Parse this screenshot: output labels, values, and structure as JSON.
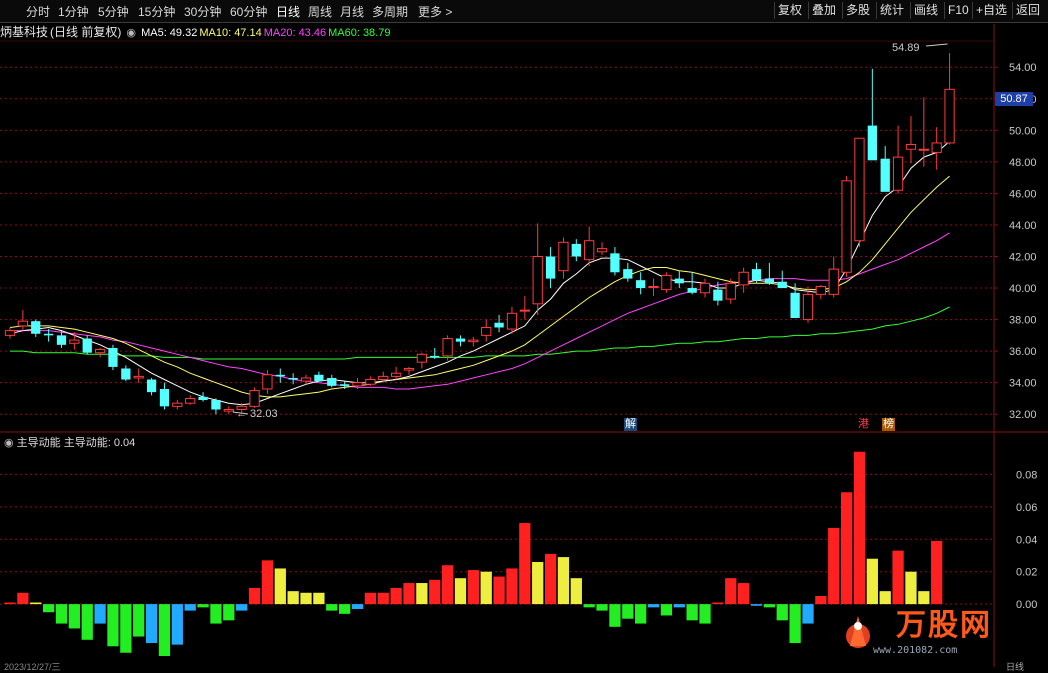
{
  "toolbar": {
    "periods": [
      "分时",
      "1分钟",
      "5分钟",
      "15分钟",
      "30分钟",
      "60分钟",
      "日线",
      "周线",
      "月线",
      "多周期",
      "更多 >"
    ],
    "active_period": "日线",
    "right_buttons": [
      "复权",
      "叠加",
      "多股",
      "统计",
      "画线",
      "F10",
      "+自选",
      "返回"
    ]
  },
  "header": {
    "stock_name": "炳基科技",
    "mode": "(日线 前复权)",
    "ma_labels": [
      {
        "text": "MA5: 49.32",
        "color": "#ffffff"
      },
      {
        "text": "MA10: 47.14",
        "color": "#ffff66"
      },
      {
        "text": "MA20: 43.46",
        "color": "#ff44ff"
      },
      {
        "text": "MA60: 38.79",
        "color": "#33ff33"
      }
    ]
  },
  "indicator": {
    "name": "主导动能",
    "value_label": "主导动能: 0.04"
  },
  "annotations": {
    "current_price": "50.87",
    "peak_label": "54.89",
    "low_label": "← 32.03",
    "tag_jie": "解",
    "tag_gang": "港",
    "tag_bang": "榜",
    "bottom_date": "2023/12/27/三",
    "bottom_right": "日线"
  },
  "watermark": {
    "text": "万股网",
    "url": "www.201082.com"
  },
  "colors": {
    "up": "#ff3b3b",
    "down": "#54ffff",
    "bar_red": "#ff2020",
    "bar_yellow": "#eeee40",
    "bar_green": "#22ee22",
    "bar_blue": "#22aaff",
    "grid": "#8a1010"
  },
  "chart_data": [
    {
      "type": "candlestick",
      "title": "",
      "ylim": [
        31,
        55.6
      ],
      "y_ticks": [
        32,
        34,
        36,
        38,
        40,
        42,
        44,
        46,
        48,
        50,
        52,
        54
      ],
      "y_tick_labels": [
        "32.00",
        "34.00",
        "36.00",
        "38.00",
        "40.00",
        "42.00",
        "44.00",
        "46.00",
        "48.00",
        "50.00",
        "52.00",
        "54.00"
      ],
      "ohlc": [
        [
          37.0,
          37.5,
          36.8,
          37.3
        ],
        [
          37.6,
          38.6,
          37.3,
          37.9
        ],
        [
          37.9,
          38.0,
          36.9,
          37.1
        ],
        [
          37.1,
          37.4,
          36.6,
          37.0
        ],
        [
          37.0,
          37.3,
          36.2,
          36.4
        ],
        [
          36.5,
          37.2,
          36.1,
          36.7
        ],
        [
          36.8,
          37.0,
          35.8,
          35.9
        ],
        [
          35.9,
          36.2,
          35.6,
          36.1
        ],
        [
          36.2,
          36.4,
          34.8,
          35.0
        ],
        [
          34.9,
          35.1,
          34.1,
          34.2
        ],
        [
          34.3,
          34.9,
          34.0,
          34.4
        ],
        [
          34.2,
          34.3,
          33.2,
          33.4
        ],
        [
          33.6,
          34.0,
          32.3,
          32.5
        ],
        [
          32.5,
          32.9,
          32.3,
          32.7
        ],
        [
          32.7,
          33.2,
          32.6,
          33.0
        ],
        [
          33.1,
          33.4,
          32.8,
          32.9
        ],
        [
          32.9,
          33.0,
          32.0,
          32.3
        ],
        [
          32.2,
          32.5,
          32.0,
          32.3
        ],
        [
          32.3,
          32.7,
          32.1,
          32.5
        ],
        [
          32.5,
          33.7,
          32.4,
          33.5
        ],
        [
          33.6,
          34.8,
          33.3,
          34.5
        ],
        [
          34.5,
          34.9,
          34.0,
          34.4
        ],
        [
          34.3,
          34.6,
          33.9,
          34.2
        ],
        [
          34.1,
          34.5,
          33.9,
          34.3
        ],
        [
          34.5,
          34.7,
          34.1,
          34.1
        ],
        [
          34.3,
          34.5,
          33.7,
          33.8
        ],
        [
          33.9,
          34.1,
          33.6,
          33.8
        ],
        [
          33.8,
          34.3,
          33.6,
          34.0
        ],
        [
          33.9,
          34.4,
          33.8,
          34.2
        ],
        [
          34.2,
          34.7,
          34.0,
          34.4
        ],
        [
          34.4,
          35.0,
          34.2,
          34.6
        ],
        [
          34.8,
          35.0,
          34.5,
          34.9
        ],
        [
          35.3,
          35.9,
          34.9,
          35.8
        ],
        [
          35.7,
          36.2,
          35.5,
          35.6
        ],
        [
          35.7,
          37.0,
          35.4,
          36.8
        ],
        [
          36.8,
          37.0,
          36.3,
          36.6
        ],
        [
          36.6,
          36.9,
          36.3,
          36.7
        ],
        [
          37.0,
          38.0,
          36.6,
          37.5
        ],
        [
          37.8,
          38.3,
          37.2,
          37.5
        ],
        [
          37.4,
          38.8,
          37.1,
          38.4
        ],
        [
          38.6,
          39.5,
          38.0,
          38.6
        ],
        [
          39.0,
          44.1,
          38.3,
          42.0
        ],
        [
          42.0,
          42.6,
          40.0,
          40.6
        ],
        [
          41.1,
          43.2,
          40.6,
          42.9
        ],
        [
          42.8,
          43.1,
          41.7,
          42.0
        ],
        [
          41.8,
          43.9,
          41.4,
          43.0
        ],
        [
          42.3,
          42.9,
          42.1,
          42.5
        ],
        [
          42.2,
          42.6,
          40.8,
          41.0
        ],
        [
          41.2,
          41.6,
          40.4,
          40.6
        ],
        [
          40.5,
          41.0,
          39.6,
          40.0
        ],
        [
          40.1,
          40.6,
          39.5,
          40.1
        ],
        [
          39.9,
          41.0,
          39.7,
          40.8
        ],
        [
          40.6,
          41.1,
          40.0,
          40.3
        ],
        [
          40.0,
          41.0,
          39.6,
          39.7
        ],
        [
          39.7,
          40.6,
          39.4,
          40.3
        ],
        [
          39.9,
          40.4,
          38.9,
          39.2
        ],
        [
          39.3,
          40.6,
          39.0,
          40.3
        ],
        [
          40.2,
          41.3,
          39.7,
          41.0
        ],
        [
          41.2,
          41.6,
          40.3,
          40.5
        ],
        [
          40.6,
          41.6,
          40.2,
          40.3
        ],
        [
          40.4,
          41.1,
          40.0,
          40.0
        ],
        [
          39.7,
          40.3,
          38.1,
          38.1
        ],
        [
          38.0,
          40.1,
          37.8,
          39.6
        ],
        [
          39.6,
          40.2,
          39.3,
          40.1
        ],
        [
          39.6,
          42.0,
          39.4,
          41.2
        ],
        [
          41.0,
          47.1,
          40.7,
          46.8
        ],
        [
          43.0,
          49.5,
          42.6,
          49.5
        ],
        [
          50.3,
          53.9,
          48.3,
          48.1
        ],
        [
          48.2,
          49.0,
          46.3,
          46.1
        ],
        [
          46.2,
          50.3,
          46.0,
          48.3
        ],
        [
          48.8,
          50.9,
          47.9,
          49.1
        ],
        [
          48.8,
          52.1,
          47.7,
          48.8
        ],
        [
          48.6,
          50.2,
          47.5,
          49.2
        ],
        [
          49.2,
          54.9,
          49.1,
          52.6
        ]
      ],
      "ma5": [
        37.1,
        37.3,
        37.4,
        37.5,
        37.3,
        37.0,
        36.7,
        36.4,
        36.0,
        35.6,
        35.1,
        34.6,
        34.2,
        33.8,
        33.4,
        33.1,
        32.9,
        32.7,
        32.6,
        32.7,
        33.0,
        33.3,
        33.6,
        33.9,
        34.1,
        34.2,
        34.1,
        34.0,
        34.0,
        34.1,
        34.2,
        34.4,
        34.7,
        35.0,
        35.3,
        35.7,
        36.0,
        36.4,
        36.8,
        37.2,
        37.6,
        38.6,
        39.3,
        40.3,
        40.9,
        41.6,
        41.9,
        41.9,
        41.8,
        41.4,
        41.0,
        40.6,
        40.4,
        40.4,
        40.3,
        40.0,
        40.0,
        40.3,
        40.5,
        40.4,
        40.3,
        39.9,
        39.8,
        39.7,
        39.9,
        41.2,
        42.9,
        44.6,
        45.8,
        46.4,
        47.6,
        48.3,
        48.6,
        49.3
      ],
      "ma10": [
        37.5,
        37.6,
        37.6,
        37.6,
        37.5,
        37.4,
        37.2,
        37.0,
        36.8,
        36.5,
        36.1,
        35.7,
        35.3,
        35.0,
        34.6,
        34.3,
        34.0,
        33.7,
        33.4,
        33.2,
        33.1,
        33.1,
        33.2,
        33.3,
        33.4,
        33.6,
        33.7,
        33.8,
        33.9,
        34.1,
        34.2,
        34.3,
        34.4,
        34.5,
        34.7,
        34.9,
        35.1,
        35.4,
        35.7,
        36.0,
        36.4,
        37.0,
        37.6,
        38.2,
        38.8,
        39.4,
        39.9,
        40.4,
        40.8,
        41.1,
        41.3,
        41.3,
        41.1,
        41.0,
        40.8,
        40.6,
        40.4,
        40.3,
        40.3,
        40.3,
        40.2,
        40.0,
        39.9,
        39.9,
        40.0,
        40.4,
        41.0,
        41.8,
        42.8,
        43.8,
        44.8,
        45.6,
        46.4,
        47.1
      ],
      "ma20": [
        37.3,
        37.3,
        37.3,
        37.3,
        37.2,
        37.1,
        37.0,
        36.9,
        36.7,
        36.6,
        36.4,
        36.2,
        36.0,
        35.8,
        35.6,
        35.4,
        35.2,
        35.0,
        34.9,
        34.7,
        34.5,
        34.4,
        34.2,
        34.1,
        34.0,
        33.9,
        33.8,
        33.7,
        33.7,
        33.7,
        33.6,
        33.6,
        33.7,
        33.8,
        33.9,
        34.1,
        34.3,
        34.5,
        34.7,
        34.9,
        35.2,
        35.6,
        36.0,
        36.4,
        36.8,
        37.2,
        37.6,
        38.0,
        38.4,
        38.7,
        39.0,
        39.3,
        39.6,
        39.8,
        40.0,
        40.2,
        40.3,
        40.4,
        40.5,
        40.6,
        40.6,
        40.6,
        40.5,
        40.5,
        40.5,
        40.6,
        40.9,
        41.2,
        41.5,
        41.8,
        42.2,
        42.6,
        43.0,
        43.5
      ],
      "ma60": [
        36.0,
        36.0,
        35.9,
        35.9,
        35.9,
        35.9,
        35.8,
        35.8,
        35.8,
        35.7,
        35.7,
        35.7,
        35.6,
        35.6,
        35.6,
        35.5,
        35.5,
        35.5,
        35.5,
        35.5,
        35.5,
        35.5,
        35.5,
        35.5,
        35.5,
        35.5,
        35.5,
        35.6,
        35.6,
        35.6,
        35.6,
        35.6,
        35.6,
        35.6,
        35.6,
        35.6,
        35.6,
        35.7,
        35.7,
        35.7,
        35.7,
        35.8,
        35.8,
        35.9,
        36.0,
        36.0,
        36.1,
        36.2,
        36.2,
        36.3,
        36.3,
        36.4,
        36.5,
        36.5,
        36.6,
        36.6,
        36.7,
        36.8,
        36.8,
        36.9,
        36.9,
        37.0,
        37.0,
        37.1,
        37.1,
        37.2,
        37.3,
        37.4,
        37.6,
        37.7,
        37.9,
        38.1,
        38.4,
        38.8
      ]
    },
    {
      "type": "bar",
      "title": "主导动能",
      "ylim": [
        -0.032,
        0.1
      ],
      "y_ticks": [
        0,
        0.02,
        0.04,
        0.06,
        0.08
      ],
      "y_tick_labels": [
        "0.00",
        "0.02",
        "0.04",
        "0.06",
        "0.08"
      ],
      "values": [
        0.001,
        0.007,
        0.001,
        -0.005,
        -0.012,
        -0.015,
        -0.022,
        -0.012,
        -0.026,
        -0.03,
        -0.02,
        -0.024,
        -0.032,
        -0.025,
        -0.004,
        -0.002,
        -0.012,
        -0.01,
        -0.004,
        0.01,
        0.027,
        0.022,
        0.008,
        0.007,
        0.007,
        -0.004,
        -0.006,
        -0.003,
        0.007,
        0.007,
        0.01,
        0.013,
        0.013,
        0.015,
        0.024,
        0.016,
        0.021,
        0.02,
        0.017,
        0.022,
        0.05,
        0.026,
        0.031,
        0.029,
        0.016,
        -0.002,
        -0.004,
        -0.014,
        -0.009,
        -0.012,
        -0.002,
        -0.007,
        -0.002,
        -0.01,
        -0.012,
        0.001,
        0.016,
        0.013,
        -0.001,
        -0.002,
        -0.01,
        -0.024,
        -0.012,
        0.005,
        0.047,
        0.069,
        0.094,
        0.028,
        0.008,
        0.033,
        0.02,
        0.008,
        0.039
      ],
      "colors": [
        "bar_red",
        "bar_red",
        "bar_yellow",
        "bar_green",
        "bar_green",
        "bar_green",
        "bar_green",
        "bar_blue",
        "bar_green",
        "bar_green",
        "bar_green",
        "bar_blue",
        "bar_green",
        "bar_blue",
        "bar_blue",
        "bar_green",
        "bar_green",
        "bar_green",
        "bar_blue",
        "bar_red",
        "bar_red",
        "bar_yellow",
        "bar_yellow",
        "bar_yellow",
        "bar_yellow",
        "bar_green",
        "bar_green",
        "bar_blue",
        "bar_red",
        "bar_red",
        "bar_red",
        "bar_red",
        "bar_yellow",
        "bar_red",
        "bar_red",
        "bar_yellow",
        "bar_red",
        "bar_yellow",
        "bar_red",
        "bar_red",
        "bar_red",
        "bar_yellow",
        "bar_red",
        "bar_yellow",
        "bar_yellow",
        "bar_green",
        "bar_green",
        "bar_green",
        "bar_green",
        "bar_green",
        "bar_blue",
        "bar_green",
        "bar_blue",
        "bar_green",
        "bar_green",
        "bar_red",
        "bar_red",
        "bar_red",
        "bar_blue",
        "bar_green",
        "bar_green",
        "bar_green",
        "bar_blue",
        "bar_red",
        "bar_red",
        "bar_red",
        "bar_red",
        "bar_yellow",
        "bar_yellow",
        "bar_red",
        "bar_yellow",
        "bar_yellow",
        "bar_red"
      ]
    }
  ]
}
